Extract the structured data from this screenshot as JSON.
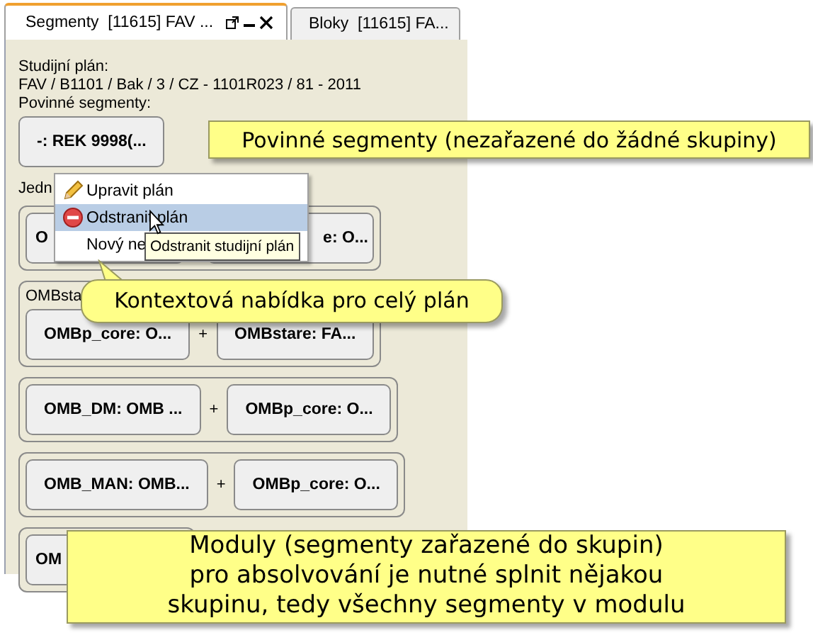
{
  "tabs": [
    {
      "label": "Segmenty  [11615] FAV ...",
      "selected": true
    },
    {
      "label": "Bloky  [11615] FA...",
      "selected": false
    }
  ],
  "plan": {
    "label": "Studijní plán:",
    "value": "FAV / B1101 / Bak / 3 / CZ - 1101R023 / 81 - 2011"
  },
  "mandatory": {
    "label": "Povinné segmenty:",
    "segments": [
      "-: REK 9998(..."
    ]
  },
  "modules": {
    "label": "Jedn",
    "groups": [
      {
        "segments": [
          {
            "text": "O"
          },
          {
            "text": "e: O..."
          }
        ]
      },
      {
        "label": "OMBsta",
        "joiner": "+",
        "segments": [
          {
            "text": "OMBp_core: O..."
          },
          {
            "text": "OMBstare: FA..."
          }
        ]
      },
      {
        "joiner": "+",
        "segments": [
          {
            "text": "OMB_DM: OMB ..."
          },
          {
            "text": "OMBp_core: O..."
          }
        ]
      },
      {
        "joiner": "+",
        "segments": [
          {
            "text": "OMB_MAN: OMB..."
          },
          {
            "text": "OMBp_core: O..."
          }
        ]
      },
      {
        "segments": [
          {
            "text": "OM"
          }
        ]
      }
    ]
  },
  "context_menu": {
    "items": [
      {
        "kind": "edit",
        "label": "Upravit plán",
        "selected": false
      },
      {
        "kind": "remove",
        "label": "Odstranit plán",
        "selected": true
      },
      {
        "kind": "plain",
        "label": "Nový ne",
        "selected": false
      }
    ],
    "tooltip": "Odstranit studijní plán"
  },
  "callouts": [
    {
      "kind": "box",
      "lines": [
        "Povinné segmenty (nezařazené do žádné skupiny)"
      ]
    },
    {
      "kind": "bubble",
      "lines": [
        "Kontextová nabídka pro celý plán"
      ]
    },
    {
      "kind": "box",
      "lines": [
        "Moduly (segmenty zařazené do skupin)",
        "pro absolvování je nutné splnit nějakou",
        "skupinu, tedy všechny segmenty v modulu"
      ]
    }
  ]
}
